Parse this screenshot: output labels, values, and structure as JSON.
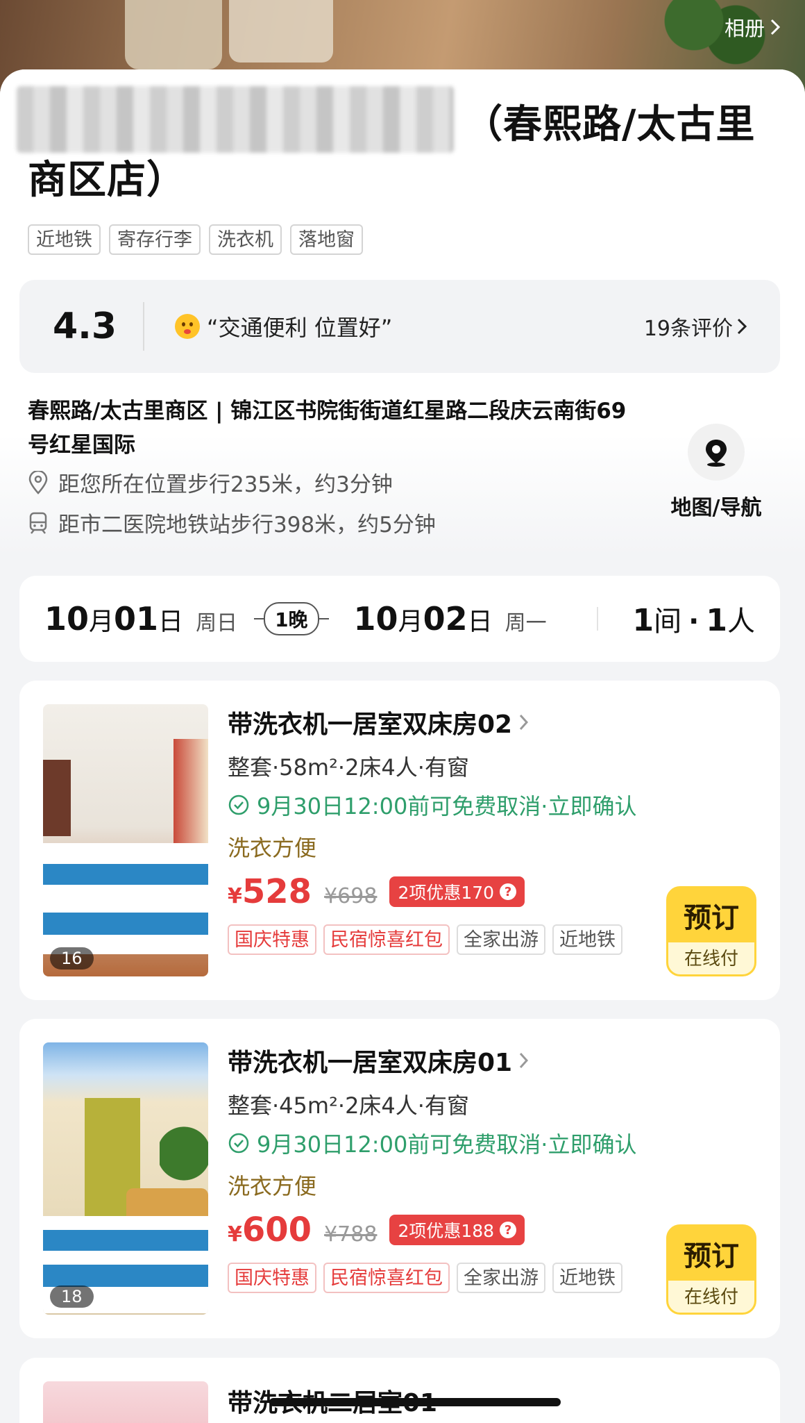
{
  "header": {
    "album_label": "相册"
  },
  "hotel": {
    "name_suffix_line1": "（春熙路/太古里",
    "name_suffix_line2": "商区店）",
    "tags": [
      "近地铁",
      "寄存行李",
      "洗衣机",
      "落地窗"
    ]
  },
  "review": {
    "score": "4.3",
    "quote": "“交通便利 位置好”",
    "count_label": "19条评价"
  },
  "location": {
    "address": "春熙路/太古里商区 | 锦江区书院街街道红星路二段庆云南街69号红星国际",
    "distance_user": "距您所在位置步行235米，约3分钟",
    "distance_metro": "距市二医院地铁站步行398米，约5分钟",
    "map_label": "地图/导航"
  },
  "stay": {
    "checkin_month": "10",
    "checkin_day": "01",
    "checkin_weekday": "周日",
    "nights": "1晚",
    "checkout_month": "10",
    "checkout_day": "02",
    "checkout_weekday": "周一",
    "rooms": "1",
    "room_unit": "间",
    "sep": "·",
    "people": "1",
    "people_unit": "人",
    "month_unit": "月",
    "day_unit": "日"
  },
  "rooms": [
    {
      "name": "带洗衣机一居室双床房02",
      "spec": "整套·58m²·2床4人·有窗",
      "cancel": "9月30日12:00前可免费取消·立即确认",
      "feature": "洗衣方便",
      "currency": "¥",
      "price": "528",
      "original": "¥698",
      "promo": "2项优惠170",
      "chips": [
        "国庆特惠",
        "民宿惊喜红包",
        "全家出游",
        "近地铁"
      ],
      "photo_count": "16",
      "book_label": "预订",
      "pay_label": "在线付"
    },
    {
      "name": "带洗衣机一居室双床房01",
      "spec": "整套·45m²·2床4人·有窗",
      "cancel": "9月30日12:00前可免费取消·立即确认",
      "feature": "洗衣方便",
      "currency": "¥",
      "price": "600",
      "original": "¥788",
      "promo": "2项优惠188",
      "chips": [
        "国庆特惠",
        "民宿惊喜红包",
        "全家出游",
        "近地铁"
      ],
      "photo_count": "18",
      "book_label": "预订",
      "pay_label": "在线付"
    }
  ],
  "peek_room": {
    "name": "带洗衣机二居室01"
  },
  "colors": {
    "accent_yellow": "#ffd43b",
    "price_red": "#e53b3b",
    "cancel_green": "#2e9e6b",
    "feature_brown": "#8a6a1f"
  }
}
